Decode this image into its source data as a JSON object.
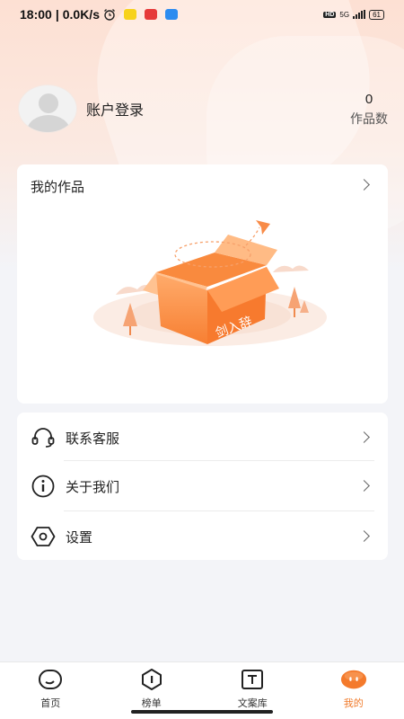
{
  "status_bar": {
    "time": "18:00",
    "speed": "0.0K/s",
    "hd": "HD",
    "network": "5G",
    "battery": "61"
  },
  "profile": {
    "login_label": "账户登录",
    "works_count": "0",
    "works_count_label": "作品数"
  },
  "my_works": {
    "title": "我的作品",
    "empty_box_text": "剑入辞"
  },
  "menu": {
    "items": [
      {
        "label": "联系客服",
        "icon": "headset-icon"
      },
      {
        "label": "关于我们",
        "icon": "info-icon"
      },
      {
        "label": "设置",
        "icon": "settings-hexagon-icon"
      }
    ]
  },
  "tabs": [
    {
      "label": "首页",
      "icon": "home-icon"
    },
    {
      "label": "榜单",
      "icon": "ranking-icon"
    },
    {
      "label": "文案库",
      "icon": "text-library-icon"
    },
    {
      "label": "我的",
      "icon": "profile-face-icon",
      "active": true
    }
  ],
  "colors": {
    "accent": "#f07a2a",
    "header_gradient_top": "#fde0d3"
  }
}
